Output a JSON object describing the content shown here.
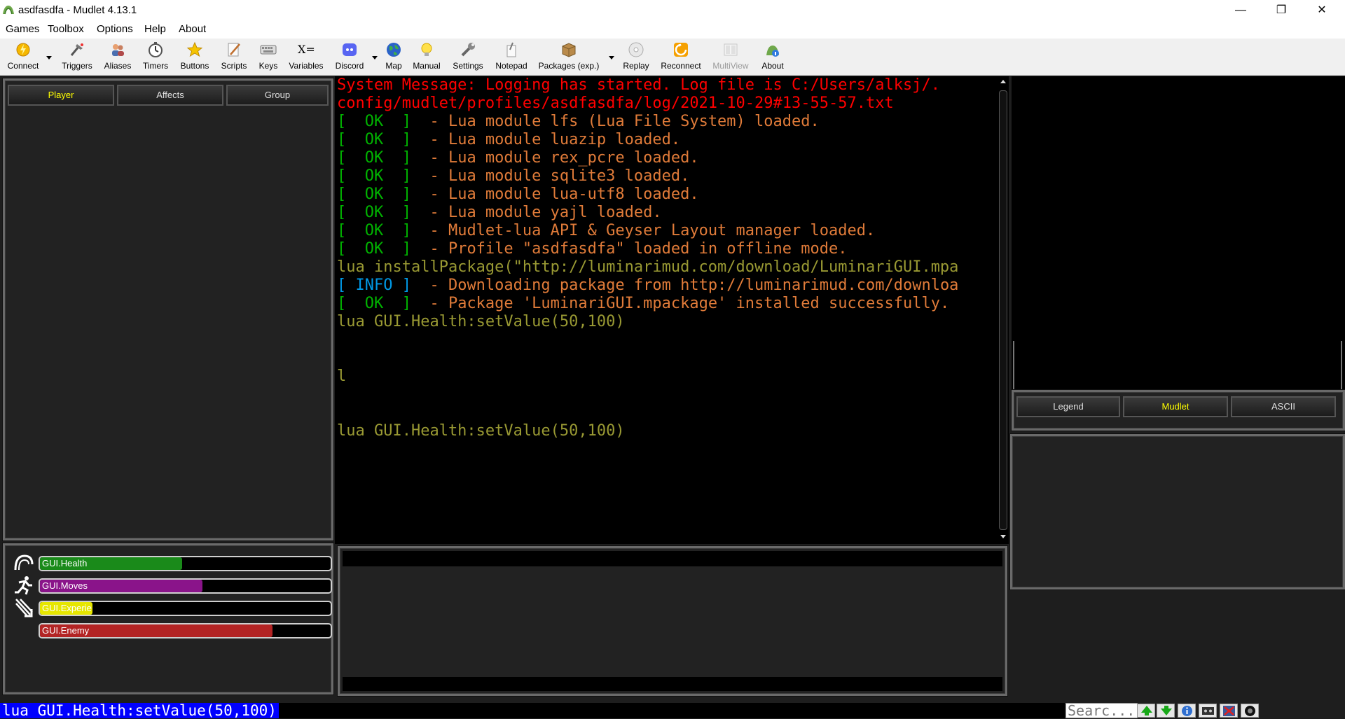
{
  "window": {
    "title": "asdfasdfa - Mudlet 4.13.1"
  },
  "menu": [
    "Games",
    "Toolbox",
    "Options",
    "Help",
    "About"
  ],
  "toolbar": {
    "connect": "Connect",
    "triggers": "Triggers",
    "aliases": "Aliases",
    "timers": "Timers",
    "buttons": "Buttons",
    "scripts": "Scripts",
    "keys": "Keys",
    "variables": "Variables",
    "discord": "Discord",
    "map": "Map",
    "manual": "Manual",
    "settings": "Settings",
    "notepad": "Notepad",
    "packages": "Packages (exp.)",
    "replay": "Replay",
    "reconnect": "Reconnect",
    "multiview": "MultiView",
    "about": "About",
    "variables_glyph": "X="
  },
  "left_tabs": [
    "Player",
    "Affects",
    "Group"
  ],
  "right_tabs": [
    "Legend",
    "Mudlet",
    "ASCII"
  ],
  "console": {
    "sys1": "System Message: Logging has started. Log file is C:/Users/alksj/.",
    "sys2": "config/mudlet/profiles/asdfasdfa/log/2021-10-29#13-55-57.txt",
    "ok": "[  OK  ]",
    "info": "[ INFO ]",
    "ok_msgs": [
      "  - Lua module lfs (Lua File System) loaded.",
      "  - Lua module luazip loaded.",
      "  - Lua module rex_pcre loaded.",
      "  - Lua module sqlite3 loaded.",
      "  - Lua module lua-utf8 loaded.",
      "  - Lua module yajl loaded.",
      "  - Mudlet-lua API & Geyser Layout manager loaded.",
      "  - Profile \"asdfasdfa\" loaded in offline mode."
    ],
    "install_cmd": "lua installPackage(\"http://luminarimud.com/download/LuminariGUI.mpa",
    "info_msg": "  - Downloading package from http://luminarimud.com/downloa",
    "installed_msg": "  - Package 'LuminariGUI.mpackage' installed successfully.",
    "cmd1": "lua GUI.Health:setValue(50,100)",
    "stray": "l",
    "cmd2": "lua GUI.Health:setValue(50,100)"
  },
  "gauges": [
    {
      "label": "GUI.Health",
      "value": 49,
      "color": "#1a8a1a"
    },
    {
      "label": "GUI.Moves",
      "value": 56,
      "color": "#8a148a"
    },
    {
      "label": "GUI.Experie",
      "value": 18,
      "color": "#e6e600"
    },
    {
      "label": "GUI.Enemy",
      "value": 80,
      "color": "#b32424"
    }
  ],
  "command_line": {
    "text": "lua GUI.Health:setValue(50,100)"
  },
  "search": {
    "placeholder": "Searc..."
  }
}
